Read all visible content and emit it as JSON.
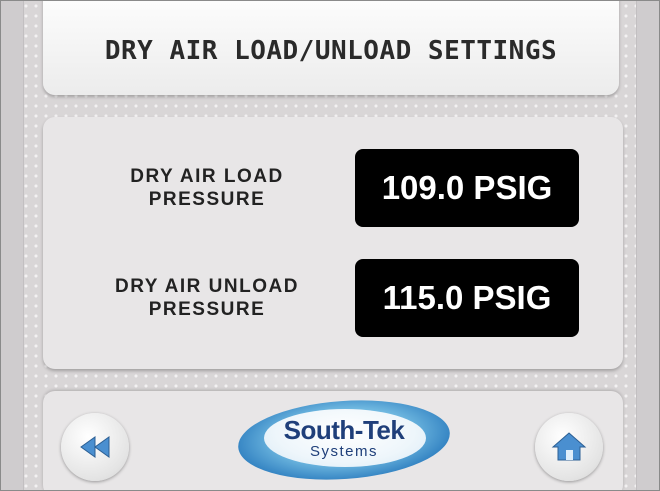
{
  "header": {
    "title": "DRY AIR LOAD/UNLOAD SETTINGS"
  },
  "settings": {
    "rows": [
      {
        "label_line1": "DRY AIR LOAD",
        "label_line2": "PRESSURE",
        "value": "109.0 PSIG"
      },
      {
        "label_line1": "DRY AIR UNLOAD",
        "label_line2": "PRESSURE",
        "value": "115.0 PSIG"
      }
    ]
  },
  "nav": {
    "back_icon": "rewind-icon",
    "home_icon": "home-icon",
    "logo_brand": "South-Tek",
    "logo_sub": "Systems"
  },
  "colors": {
    "background": "#d9d6d7",
    "panel": "#e8e6e7",
    "value_box": "#000000",
    "value_text": "#ffffff",
    "icon_blue": "#4a8fd0",
    "logo_blue": "#2f7fc0",
    "logo_text": "#1f3f7a"
  }
}
